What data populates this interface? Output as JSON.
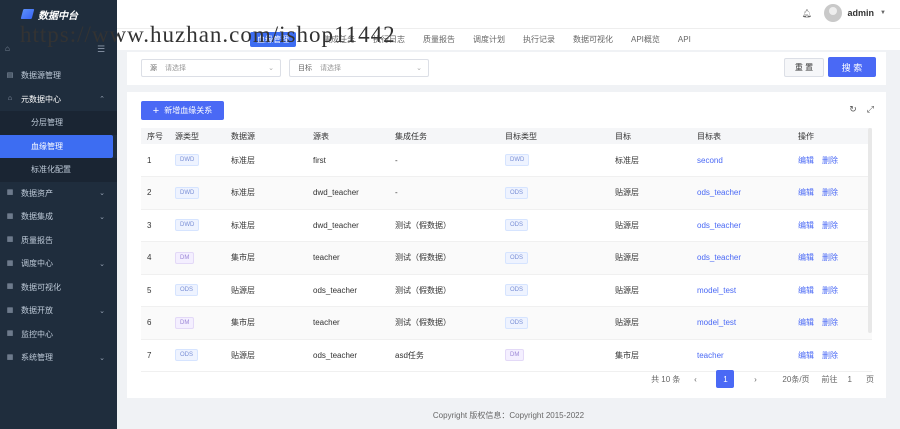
{
  "app": {
    "title": "数据中台"
  },
  "watermark": "https://www.huzhan.com/ishop11442",
  "header": {
    "username": "admin"
  },
  "sidebar": {
    "items": [
      {
        "label": "数据源管理",
        "icon": "database-icon",
        "has_arrow": false
      },
      {
        "label": "元数据中心",
        "icon": "home-icon",
        "has_arrow": true,
        "open": true
      },
      {
        "label": "数据资产",
        "icon": "grid-icon",
        "has_arrow": true
      },
      {
        "label": "数据集成",
        "icon": "grid-icon",
        "has_arrow": true
      },
      {
        "label": "质量报告",
        "icon": "grid-icon",
        "has_arrow": false
      },
      {
        "label": "调度中心",
        "icon": "grid-icon",
        "has_arrow": true
      },
      {
        "label": "数据可视化",
        "icon": "grid-icon",
        "has_arrow": false
      },
      {
        "label": "数据开放",
        "icon": "grid-icon",
        "has_arrow": true
      },
      {
        "label": "监控中心",
        "icon": "grid-icon",
        "has_arrow": false
      },
      {
        "label": "系统管理",
        "icon": "grid-icon",
        "has_arrow": true
      }
    ],
    "subitems": [
      {
        "label": "分层管理"
      },
      {
        "label": "血缘管理",
        "active": true
      },
      {
        "label": "标准化配置"
      }
    ]
  },
  "tabs": [
    "血缘管理",
    "",
    "集成任务",
    "执行日志",
    "质量报告",
    "调度计划",
    "执行记录",
    "数据可视化",
    "API概览",
    "API"
  ],
  "filter": {
    "source_label": "源",
    "source_placeholder": "请选择",
    "target_label": "目标",
    "target_placeholder": "请选择",
    "reset_label": "重 置",
    "search_label": "搜 索"
  },
  "toolbar": {
    "add_label": "新增血缘关系"
  },
  "table": {
    "headers": [
      "序号",
      "源类型",
      "数据源",
      "源表",
      "集成任务",
      "目标类型",
      "目标",
      "目标表",
      "操作"
    ],
    "rows": [
      {
        "no": "1",
        "src_type": "DWD",
        "src": "标准层",
        "src_table": "first",
        "task": "-",
        "tgt_type": "DWD",
        "tgt": "标准层",
        "tgt_table": "second"
      },
      {
        "no": "2",
        "src_type": "DWD",
        "src": "标准层",
        "src_table": "dwd_teacher",
        "task": "-",
        "tgt_type": "ODS",
        "tgt": "贴源层",
        "tgt_table": "ods_teacher"
      },
      {
        "no": "3",
        "src_type": "DWD",
        "src": "标准层",
        "src_table": "dwd_teacher",
        "task": "测试（假数据）",
        "tgt_type": "ODS",
        "tgt": "贴源层",
        "tgt_table": "ods_teacher"
      },
      {
        "no": "4",
        "src_type": "DM",
        "src": "集市层",
        "src_table": "teacher",
        "task": "测试（假数据）",
        "tgt_type": "ODS",
        "tgt": "贴源层",
        "tgt_table": "ods_teacher"
      },
      {
        "no": "5",
        "src_type": "ODS",
        "src": "贴源层",
        "src_table": "ods_teacher",
        "task": "测试（假数据）",
        "tgt_type": "ODS",
        "tgt": "贴源层",
        "tgt_table": "model_test"
      },
      {
        "no": "6",
        "src_type": "DM",
        "src": "集市层",
        "src_table": "teacher",
        "task": "测试（假数据）",
        "tgt_type": "ODS",
        "tgt": "贴源层",
        "tgt_table": "model_test"
      },
      {
        "no": "7",
        "src_type": "ODS",
        "src": "贴源层",
        "src_table": "ods_teacher",
        "task": "asd任务",
        "tgt_type": "DM",
        "tgt": "集市层",
        "tgt_table": "teacher"
      }
    ],
    "edit_label": "编辑",
    "delete_label": "删除"
  },
  "pagination": {
    "total": "共 10 条",
    "current": "1",
    "page_size": "20条/页",
    "goto_label": "前往",
    "goto_value": "1",
    "page_suffix": "页"
  },
  "footer": "Copyright 版权信息：Copyright 2015-2022",
  "colors": {
    "primary": "#4a69f5",
    "sidebar_bg": "#1f2d3d"
  }
}
